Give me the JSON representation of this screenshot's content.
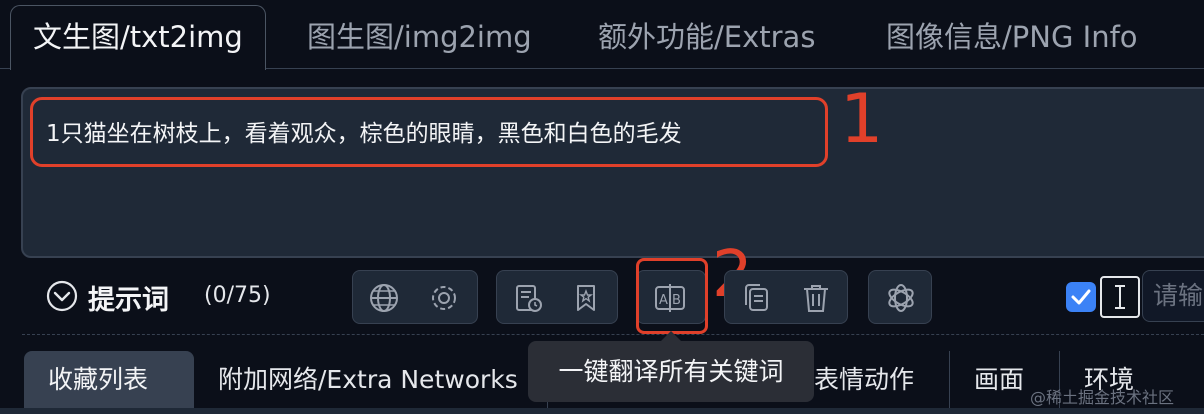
{
  "top_tabs": [
    {
      "label": "文生图/txt2img"
    },
    {
      "label": "图生图/img2img"
    },
    {
      "label": "额外功能/Extras"
    },
    {
      "label": "图像信息/PNG Info"
    }
  ],
  "prompt": {
    "text": "1只猫坐在树枝上，看着观众，棕色的眼睛，黑色和白色的毛发"
  },
  "annotations": {
    "one": "1",
    "two": "2"
  },
  "toolbar": {
    "label": "提示词",
    "count": "(0/75)",
    "icons": [
      "globe-icon",
      "gear-icon",
      "history-icon",
      "bookmark-icon",
      "translate-icon",
      "copy-icon",
      "trash-icon",
      "openai-icon"
    ],
    "checkbox_checked": true,
    "input_placeholder": "请输"
  },
  "tooltip": "一键翻译所有关键词",
  "bottom_tabs": [
    {
      "label": "收藏列表"
    },
    {
      "label": "附加网络/Extra Networks"
    },
    {
      "label": "表情动作"
    },
    {
      "label": "画面"
    },
    {
      "label": "环境"
    }
  ],
  "watermark": "@稀土掘金技术社区",
  "colors": {
    "accent": "#3b82f6",
    "highlight": "#e0402a",
    "background": "#0b0f19"
  }
}
